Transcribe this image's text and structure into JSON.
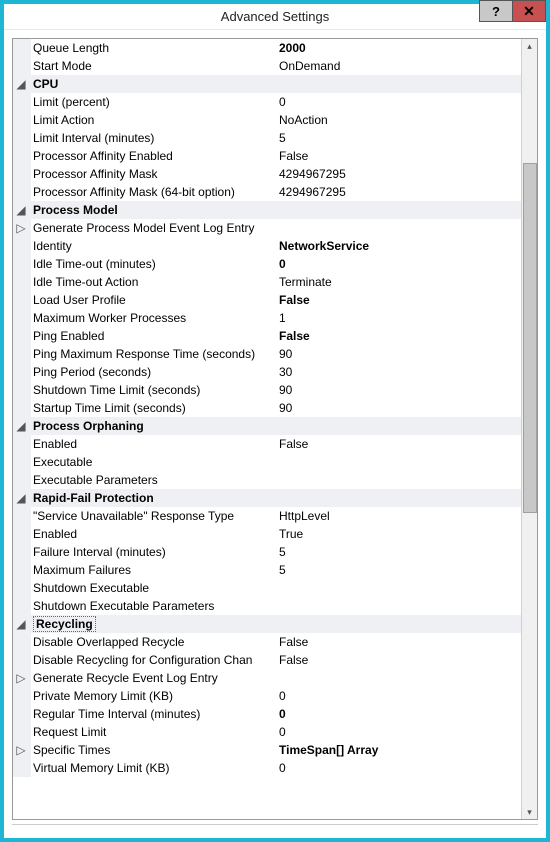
{
  "window": {
    "title": "Advanced Settings"
  },
  "rows": [
    {
      "type": "prop",
      "label": "Queue Length",
      "value": "2000",
      "bold": true
    },
    {
      "type": "prop",
      "label": "Start Mode",
      "value": "OnDemand"
    },
    {
      "type": "cat",
      "label": "CPU",
      "glyph": "◢"
    },
    {
      "type": "prop",
      "label": "Limit (percent)",
      "value": "0"
    },
    {
      "type": "prop",
      "label": "Limit Action",
      "value": "NoAction"
    },
    {
      "type": "prop",
      "label": "Limit Interval (minutes)",
      "value": "5"
    },
    {
      "type": "prop",
      "label": "Processor Affinity Enabled",
      "value": "False"
    },
    {
      "type": "prop",
      "label": "Processor Affinity Mask",
      "value": "4294967295"
    },
    {
      "type": "prop",
      "label": "Processor Affinity Mask (64-bit option)",
      "value": "4294967295"
    },
    {
      "type": "cat",
      "label": "Process Model",
      "glyph": "◢"
    },
    {
      "type": "prop",
      "label": "Generate Process Model Event Log Entry",
      "value": "",
      "glyph": "▷"
    },
    {
      "type": "prop",
      "label": "Identity",
      "value": "NetworkService",
      "bold": true
    },
    {
      "type": "prop",
      "label": "Idle Time-out (minutes)",
      "value": "0",
      "bold": true
    },
    {
      "type": "prop",
      "label": "Idle Time-out Action",
      "value": "Terminate"
    },
    {
      "type": "prop",
      "label": "Load User Profile",
      "value": "False",
      "bold": true
    },
    {
      "type": "prop",
      "label": "Maximum Worker Processes",
      "value": "1"
    },
    {
      "type": "prop",
      "label": "Ping Enabled",
      "value": "False",
      "bold": true
    },
    {
      "type": "prop",
      "label": "Ping Maximum Response Time (seconds)",
      "value": "90"
    },
    {
      "type": "prop",
      "label": "Ping Period (seconds)",
      "value": "30"
    },
    {
      "type": "prop",
      "label": "Shutdown Time Limit (seconds)",
      "value": "90"
    },
    {
      "type": "prop",
      "label": "Startup Time Limit (seconds)",
      "value": "90"
    },
    {
      "type": "cat",
      "label": "Process Orphaning",
      "glyph": "◢"
    },
    {
      "type": "prop",
      "label": "Enabled",
      "value": "False"
    },
    {
      "type": "prop",
      "label": "Executable",
      "value": ""
    },
    {
      "type": "prop",
      "label": "Executable Parameters",
      "value": ""
    },
    {
      "type": "cat",
      "label": "Rapid-Fail Protection",
      "glyph": "◢"
    },
    {
      "type": "prop",
      "label": "\"Service Unavailable\" Response Type",
      "value": "HttpLevel"
    },
    {
      "type": "prop",
      "label": "Enabled",
      "value": "True"
    },
    {
      "type": "prop",
      "label": "Failure Interval (minutes)",
      "value": "5"
    },
    {
      "type": "prop",
      "label": "Maximum Failures",
      "value": "5"
    },
    {
      "type": "prop",
      "label": "Shutdown Executable",
      "value": ""
    },
    {
      "type": "prop",
      "label": "Shutdown Executable Parameters",
      "value": ""
    },
    {
      "type": "cat",
      "label": "Recycling",
      "glyph": "◢",
      "selected": true
    },
    {
      "type": "prop",
      "label": "Disable Overlapped Recycle",
      "value": "False"
    },
    {
      "type": "prop",
      "label": "Disable Recycling for Configuration Changes",
      "value": "False",
      "clipLabel": "Disable Recycling for Configuration Chan"
    },
    {
      "type": "prop",
      "label": "Generate Recycle Event Log Entry",
      "value": "",
      "glyph": "▷"
    },
    {
      "type": "prop",
      "label": "Private Memory Limit (KB)",
      "value": "0"
    },
    {
      "type": "prop",
      "label": "Regular Time Interval (minutes)",
      "value": "0",
      "bold": true
    },
    {
      "type": "prop",
      "label": "Request Limit",
      "value": "0"
    },
    {
      "type": "prop",
      "label": "Specific Times",
      "value": "TimeSpan[] Array",
      "bold": true,
      "glyph": "▷"
    },
    {
      "type": "prop",
      "label": "Virtual Memory Limit (KB)",
      "value": "0"
    }
  ]
}
